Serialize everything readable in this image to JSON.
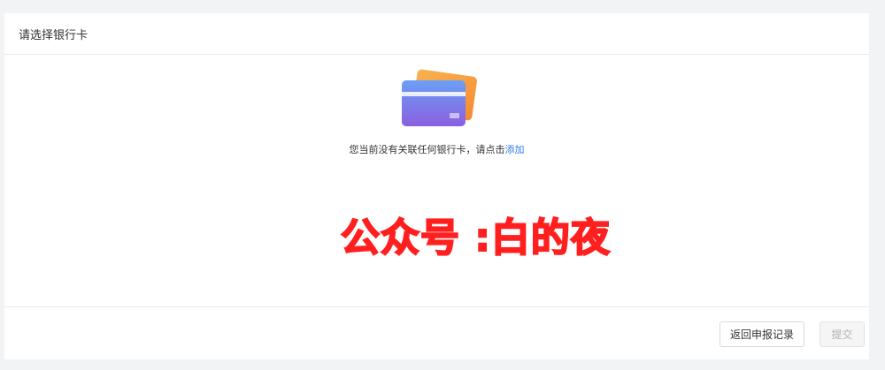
{
  "header": {
    "title": "请选择银行卡"
  },
  "empty_state": {
    "message": "您当前没有关联任何银行卡，请点击",
    "add_link": "添加",
    "illustration": "bank-card-illustration"
  },
  "watermark": {
    "text": "公众号 :白的夜"
  },
  "footer": {
    "back_button": "返回申报记录",
    "submit_button": "提交"
  },
  "colors": {
    "link": "#2f7ce8",
    "watermark": "#ff1f1f",
    "card_back": "#f7a346",
    "card_front_top": "#6aa0f5",
    "card_front_bottom": "#8b5fe0"
  }
}
